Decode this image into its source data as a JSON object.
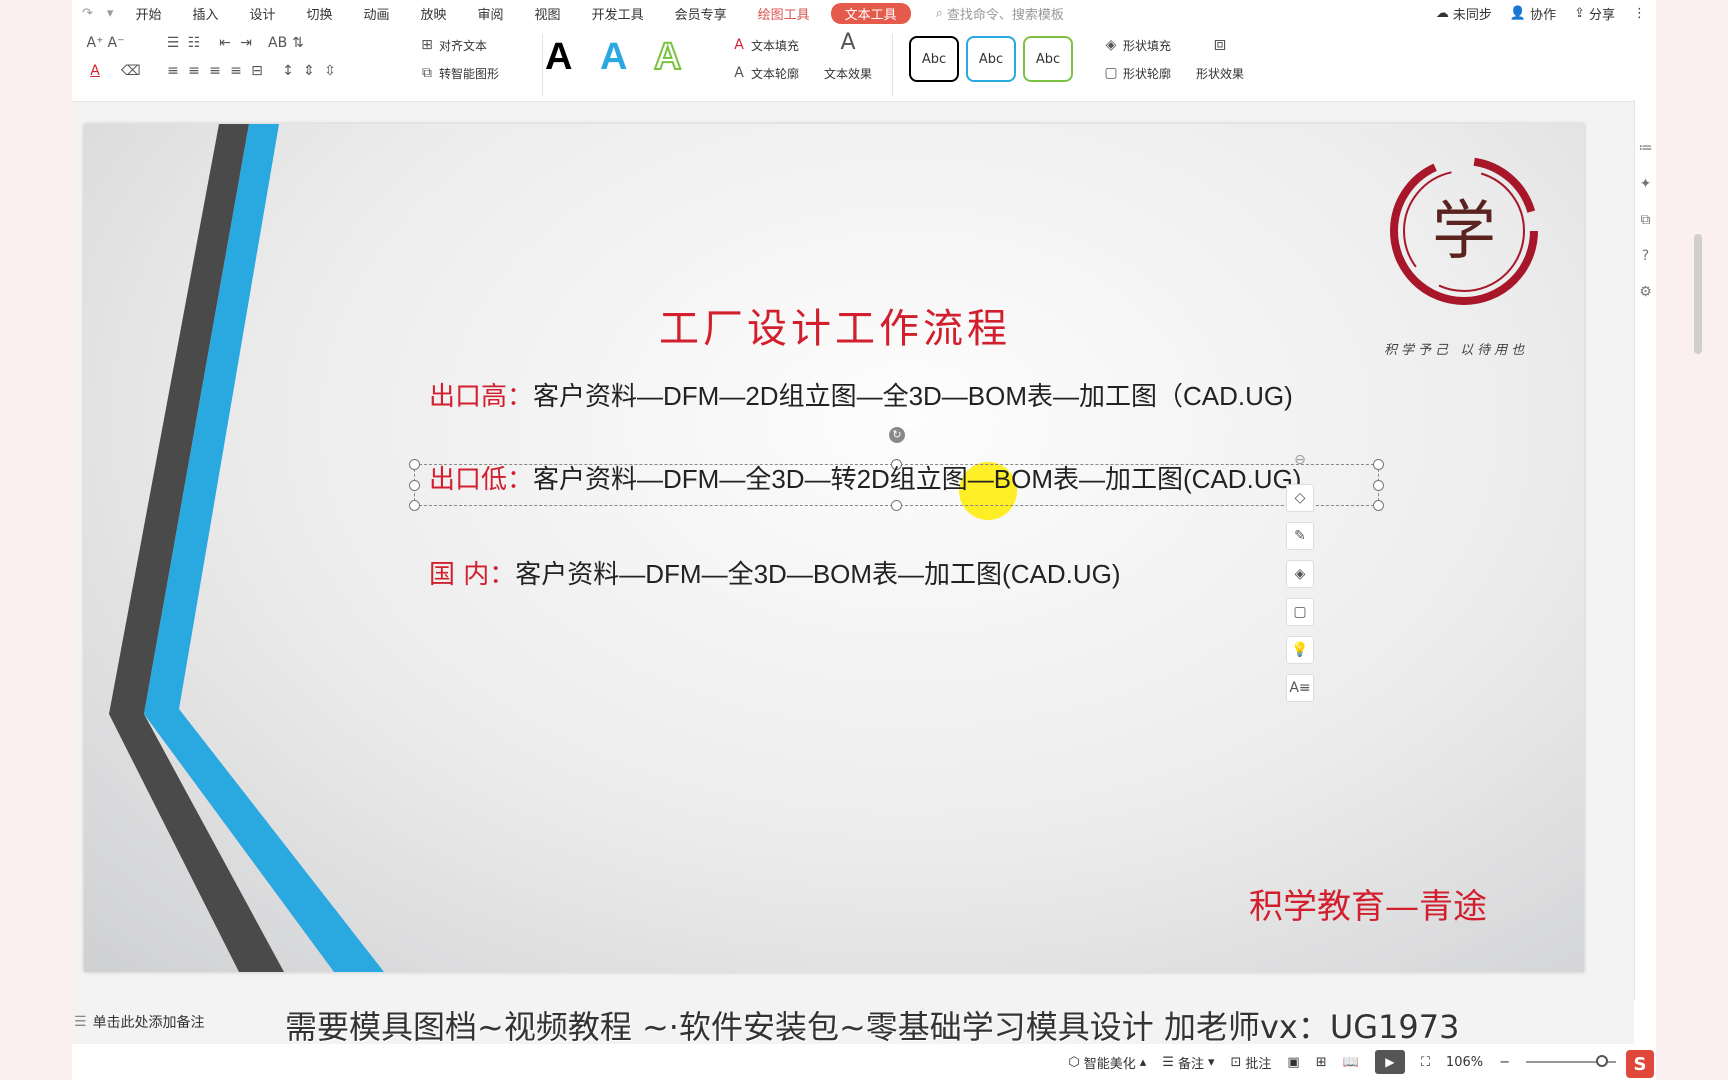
{
  "menubar": {
    "tabs": [
      "开始",
      "插入",
      "设计",
      "切换",
      "动画",
      "放映",
      "审阅",
      "视图",
      "开发工具",
      "会员专享",
      "绘图工具",
      "文本工具"
    ],
    "search_placeholder": "查找命令、搜索模板",
    "sync_label": "未同步",
    "collab_label": "协作",
    "share_label": "分享"
  },
  "toolbar": {
    "align_text": "对齐文本",
    "convert_smartart": "转智能图形",
    "text_fill": "文本填充",
    "text_outline": "文本轮廓",
    "text_effect": "文本效果",
    "shape_fill": "形状填充",
    "shape_outline": "形状轮廓",
    "shape_effect": "形状效果",
    "style_sample": "Abc",
    "big_a": "A"
  },
  "slide": {
    "title": "工厂设计工作流程",
    "rows": [
      {
        "key": "出口高：",
        "value": "客户资料—DFM—2D组立图—全3D—BOM表—加工图（CAD.UG)"
      },
      {
        "key": "出口低：",
        "value": "客户资料—DFM—全3D—转2D组立图—BOM表—加工图(CAD.UG)"
      },
      {
        "key": "国 内：",
        "value": "客户资料—DFM—全3D—BOM表—加工图(CAD.UG)"
      }
    ],
    "seal_char": "学",
    "seal_caption": "积学予己 以待用也",
    "brand": "积学教育—青途"
  },
  "notes": {
    "placeholder": "单击此处添加备注"
  },
  "subtitle": "需要模具图档~视频教程 ~·软件安装包~零基础学习模具设计 加老师vx：UG1973",
  "statusbar": {
    "beautify": "智能美化",
    "notes": "备注",
    "comments": "批注",
    "zoom": "106%"
  },
  "colors": {
    "accent_red": "#d21f2e",
    "active_tab": "#e45b4c",
    "stripe_blue": "#2aa8e0",
    "stripe_gray": "#4a4a4a"
  }
}
